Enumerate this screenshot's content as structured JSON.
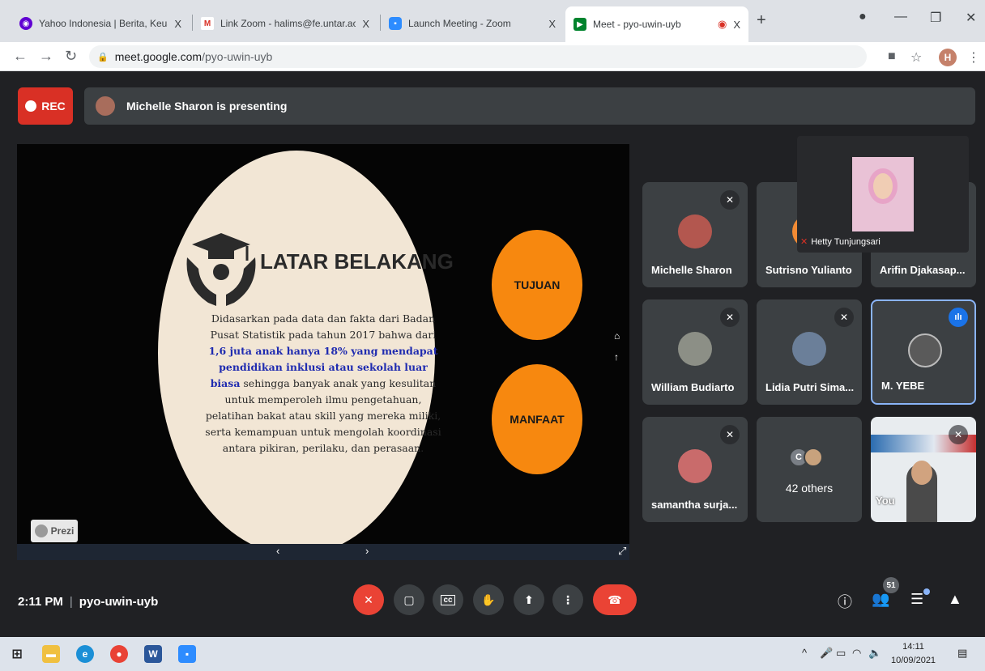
{
  "browser": {
    "tabs": [
      {
        "title": "Yahoo Indonesia | Berita, Keuangan",
        "active": false
      },
      {
        "title": "Link Zoom - halims@fe.untar.ac.id",
        "active": false
      },
      {
        "title": "Launch Meeting - Zoom",
        "active": false
      },
      {
        "title": "Meet - pyo-uwin-uyb",
        "active": true
      }
    ],
    "close_glyph": "X",
    "url_host": "meet.google.com",
    "url_path": "/pyo-uwin-uyb",
    "profile_initial": "H"
  },
  "meet": {
    "rec_label": "REC",
    "presenting_text": "Michelle Sharon is presenting",
    "time": "2:11 PM",
    "meeting_code": "pyo-uwin-uyb",
    "people_count": "51",
    "accent_color": "#1a73e8",
    "end_color": "#ea4335"
  },
  "slide": {
    "title": "LATAR BELAKANG",
    "body_pre": "Didasarkan pada data dan fakta  dari Badan Pusat Statistik pada tahun 2017 bahwa dari ",
    "body_highlight": "1,6 juta anak hanya 18% yang mendapat pendidikan inklusi atau sekolah luar biasa",
    "body_post": " sehingga banyak anak yang kesulitan untuk memperoleh ilmu pengetahuan, pelatihan bakat atau skill yang mereka miliki, serta kemampuan untuk mengolah koordinasi antara pikiran, perilaku, dan perasaan.",
    "orb_1": "TUJUAN",
    "orb_2": "MANFAAT",
    "logo": "Prezi"
  },
  "participants": {
    "pinned_name": "Hetty Tunjungsari",
    "tiles": [
      {
        "name": "Michelle Sharon"
      },
      {
        "name": "Sutrisno Yulianto"
      },
      {
        "name": "Arifin Djakasap..."
      },
      {
        "name": "William Budiarto"
      },
      {
        "name": "Lidia Putri Sima..."
      },
      {
        "name": "M. YEBE"
      },
      {
        "name": "samantha surja..."
      }
    ],
    "others_initial": "C",
    "others_label": "42 others",
    "you_label": "You"
  },
  "taskbar": {
    "time": "14:11",
    "date": "10/09/2021"
  }
}
